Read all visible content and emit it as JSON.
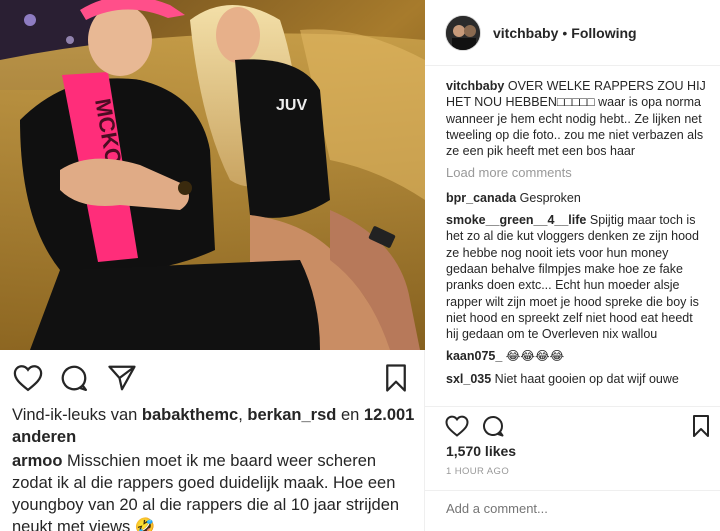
{
  "left": {
    "likes": {
      "prefix": "Vind-ik-leuks van ",
      "user1": "babakthemc",
      "sep": ", ",
      "user2": "berkan_rsd",
      "mid": " en ",
      "count": "12.001",
      "suffix": " anderen"
    },
    "comment": {
      "user": "armoo",
      "text": "Misschien moet ik me baard weer scheren zodat ik al die rappers goed duidelijk maak. Hoe een youngboy van 20 al die rappers die al 10 jaar strijden neukt met views 🤣"
    },
    "shirt_text": "MCKOOL"
  },
  "right": {
    "username": "vitchbaby",
    "dot": "•",
    "follow_status": "Following",
    "caption": {
      "user": "vitchbaby",
      "text": "OVER WELKE RAPPERS ZOU HIJ HET NOU HEBBEN□□□□□ waar is opa norma wanneer je hem echt nodig hebt.. Ze lijken net tweeling op die foto.. zou me niet verbazen als ze een pik heeft met een bos haar"
    },
    "load_more": "Load more comments",
    "comments": [
      {
        "user": "bpr_canada",
        "text": "Gesproken"
      },
      {
        "user": "smoke__green__4__life",
        "text": "Spijtig maar toch is het zo al die kut vloggers denken ze zijn hood ze hebbe nog nooit iets voor hun money gedaan behalve filmpjes make hoe ze fake pranks doen extc... Echt hun moeder alsje rapper wilt zijn moet je hood spreke die boy is niet hood en spreekt zelf niet hood eat heedt hij gedaan om te Overleven nix wallou"
      },
      {
        "user": "kaan075_",
        "text": "😂😂😂😂"
      },
      {
        "user": "sxl_035",
        "text": "Niet haat gooien op dat wijf ouwe"
      }
    ],
    "likes": "1,570 likes",
    "time": "1 HOUR AGO",
    "add_comment_placeholder": "Add a comment..."
  },
  "colors": {
    "text": "#262626",
    "muted": "#999999",
    "divider": "#efefef",
    "sash": "#ff2d7a",
    "cap": "#ff4f8a"
  }
}
